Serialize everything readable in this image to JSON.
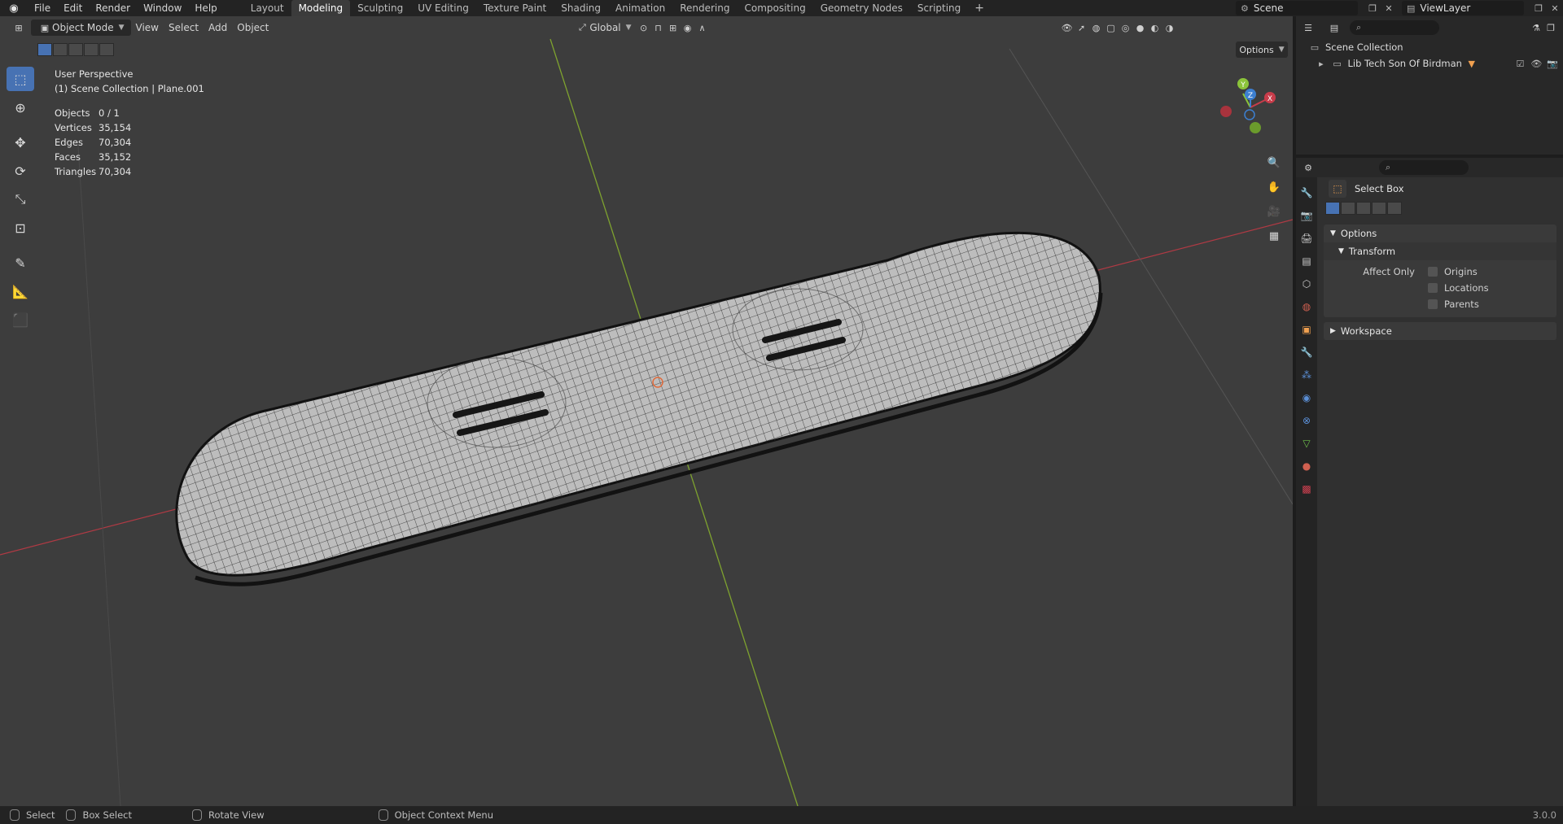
{
  "menu": [
    "File",
    "Edit",
    "Render",
    "Window",
    "Help"
  ],
  "workspaces": [
    "Layout",
    "Modeling",
    "Sculpting",
    "UV Editing",
    "Texture Paint",
    "Shading",
    "Animation",
    "Rendering",
    "Compositing",
    "Geometry Nodes",
    "Scripting"
  ],
  "active_workspace": "Modeling",
  "scene_name": "Scene",
  "view_layer": "ViewLayer",
  "viewport_header": {
    "mode": "Object Mode",
    "menus": [
      "View",
      "Select",
      "Add",
      "Object"
    ],
    "orientation": "Global",
    "options_label": "Options"
  },
  "overlay": {
    "view_name": "User Perspective",
    "collection_line": "(1) Scene Collection | Plane.001",
    "stats": [
      {
        "label": "Objects",
        "value": "0 / 1"
      },
      {
        "label": "Vertices",
        "value": "35,154"
      },
      {
        "label": "Edges",
        "value": "70,304"
      },
      {
        "label": "Faces",
        "value": "35,152"
      },
      {
        "label": "Triangles",
        "value": "70,304"
      }
    ]
  },
  "gizmo_axes": [
    "X",
    "Y",
    "Z"
  ],
  "outliner": {
    "root": "Scene Collection",
    "items": [
      {
        "name": "Lib Tech Son Of Birdman"
      }
    ]
  },
  "properties": {
    "tool_name": "Select Box",
    "options_panel": "Options",
    "transform_sub": "Transform",
    "affect_only_label": "Affect Only",
    "checkboxes": [
      "Origins",
      "Locations",
      "Parents"
    ],
    "workspace_panel": "Workspace"
  },
  "statusbar": {
    "items": [
      "Select",
      "Box Select",
      "Rotate View",
      "Object Context Menu"
    ],
    "version": "3.0.0"
  },
  "colors": {
    "accent": "#4772b3",
    "x_axis": "#c83c4a",
    "y_axis": "#8bc43a",
    "z_axis": "#3c7fd0"
  }
}
